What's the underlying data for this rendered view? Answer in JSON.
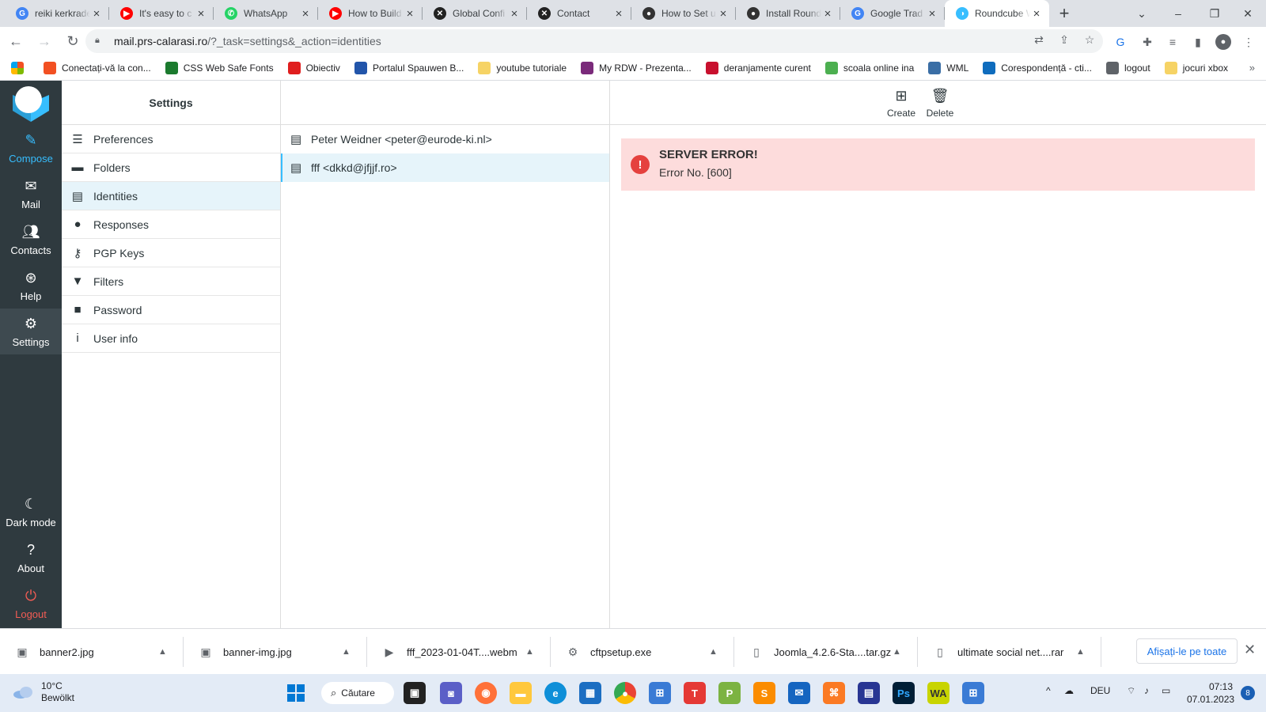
{
  "browser": {
    "tabs": [
      {
        "title": "reiki kerkrade",
        "icon": "google-icon",
        "color": "#4285f4",
        "glyph": "G"
      },
      {
        "title": "It's easy to c",
        "icon": "youtube-icon",
        "color": "#ff0000",
        "glyph": "▶"
      },
      {
        "title": "WhatsApp",
        "icon": "whatsapp-icon",
        "color": "#25d366",
        "glyph": "✆"
      },
      {
        "title": "How to Build",
        "icon": "youtube-icon",
        "color": "#ff0000",
        "glyph": "▶"
      },
      {
        "title": "Global Confi",
        "icon": "joomla-icon",
        "color": "#222222",
        "glyph": "✕"
      },
      {
        "title": "Contact",
        "icon": "joomla-icon",
        "color": "#222222",
        "glyph": "✕"
      },
      {
        "title": "How to Set u",
        "icon": "github-icon",
        "color": "#333333",
        "glyph": "●"
      },
      {
        "title": "Install Round",
        "icon": "github-icon",
        "color": "#333333",
        "glyph": "●"
      },
      {
        "title": "Google Trad",
        "icon": "google-translate-icon",
        "color": "#4285f4",
        "glyph": "G"
      },
      {
        "title": "Roundcube W",
        "icon": "roundcube-icon",
        "color": "#37beff",
        "glyph": "◑"
      }
    ],
    "url_host": "mail.prs-calarasi.ro",
    "url_path": "/?_task=settings&_action=identities",
    "bookmarks": [
      {
        "label": "Conectați-vă la con...",
        "color": "#f25022"
      },
      {
        "label": "CSS Web Safe Fonts",
        "color": "#1b7a2e"
      },
      {
        "label": "Obiectiv",
        "color": "#e01e1e"
      },
      {
        "label": "Portalul Spauwen B...",
        "color": "#2255aa"
      },
      {
        "label": "youtube tutoriale",
        "color": "#f6d365"
      },
      {
        "label": "My RDW - Prezenta...",
        "color": "#7a2a7a"
      },
      {
        "label": "deranjamente curent",
        "color": "#c8102e"
      },
      {
        "label": "scoala online ina",
        "color": "#4caf50"
      },
      {
        "label": "WML",
        "color": "#3a6ea5"
      },
      {
        "label": "Corespondență - cti...",
        "color": "#0f6cbd"
      },
      {
        "label": "logout",
        "color": "#5f6368"
      },
      {
        "label": "jocuri xbox",
        "color": "#f6d365"
      }
    ]
  },
  "app": {
    "nav": {
      "compose": "Compose",
      "mail": "Mail",
      "contacts": "Contacts",
      "help": "Help",
      "settings": "Settings",
      "dark_mode": "Dark mode",
      "about": "About",
      "logout": "Logout"
    },
    "settings_title": "Settings",
    "settings_menu": [
      {
        "label": "Preferences",
        "icon": "sliders-icon",
        "glyph": "☰"
      },
      {
        "label": "Folders",
        "icon": "folder-icon",
        "glyph": "▬"
      },
      {
        "label": "Identities",
        "icon": "id-card-icon",
        "glyph": "▤"
      },
      {
        "label": "Responses",
        "icon": "comment-icon",
        "glyph": "●"
      },
      {
        "label": "PGP Keys",
        "icon": "key-icon",
        "glyph": "⚷"
      },
      {
        "label": "Filters",
        "icon": "filter-icon",
        "glyph": "▼"
      },
      {
        "label": "Password",
        "icon": "lock-icon",
        "glyph": "■"
      },
      {
        "label": "User info",
        "icon": "info-icon",
        "glyph": "i"
      }
    ],
    "selected_menu_index": 2,
    "identities": [
      "Peter Weidner <peter@eurode-ki.nl>",
      "fff <dkkd@jfjjf.ro>"
    ],
    "selected_identity_index": 1,
    "toolbar": {
      "create": "Create",
      "delete": "Delete"
    },
    "error": {
      "title": "SERVER ERROR!",
      "message": "Error No. [600]"
    }
  },
  "downloads": {
    "items": [
      {
        "name": "banner2.jpg",
        "icon": "image-file-icon"
      },
      {
        "name": "banner-img.jpg",
        "icon": "image-file-icon"
      },
      {
        "name": "fff_2023-01-04T....webm",
        "icon": "video-file-icon"
      },
      {
        "name": "cftpsetup.exe",
        "icon": "installer-file-icon"
      },
      {
        "name": "Joomla_4.2.6-Sta....tar.gz",
        "icon": "file-icon"
      },
      {
        "name": "ultimate social net....rar",
        "icon": "file-icon"
      }
    ],
    "show_all": "Afișați-le pe toate"
  },
  "taskbar": {
    "weather_temp": "10°C",
    "weather_desc": "Bewölkt",
    "search": "Căutare",
    "language": "DEU",
    "time": "07:13",
    "date": "07.01.2023",
    "notifications": "8"
  }
}
